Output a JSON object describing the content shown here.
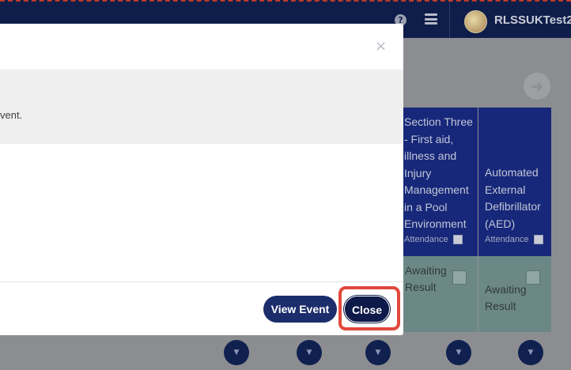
{
  "header": {
    "username": "RLSSUKTest2",
    "help_icon_glyph": "?",
    "icons": [
      "help-icon",
      "menu-icon",
      "avatar"
    ]
  },
  "table": {
    "columns": [
      {
        "title": "Section Three - First aid, illness and Injury Management in a Pool Environment",
        "title_lines": [
          "Section Three",
          "- First aid,",
          "illness and",
          "Injury",
          "Management",
          "in a Pool",
          "Environment"
        ],
        "attendance_label": "Attendance",
        "result": "Awaiting Result",
        "result_lines": [
          "Awaiting",
          "Result"
        ]
      },
      {
        "title": "Automated External Defibrillator (AED)",
        "title_lines": [
          "Automated",
          "External",
          "Defibrillator",
          "(AED)"
        ],
        "attendance_label": "Attendance",
        "result": "Awaiting Result",
        "result_lines": [
          "Awaiting",
          "Result"
        ]
      }
    ],
    "dropdown_glyph": "▼",
    "dropdown_count": 5
  },
  "modal": {
    "close_glyph": "×",
    "message": "vent.",
    "view_event_label": "View Event",
    "close_label": "Close"
  },
  "colors": {
    "header_bg": "#0e1d4a",
    "primary_button": "#1b2d6b",
    "close_button": "#0d1a4a",
    "highlight": "#e2483d",
    "column_header": "#17287a",
    "result_cell": "#6c8886"
  }
}
